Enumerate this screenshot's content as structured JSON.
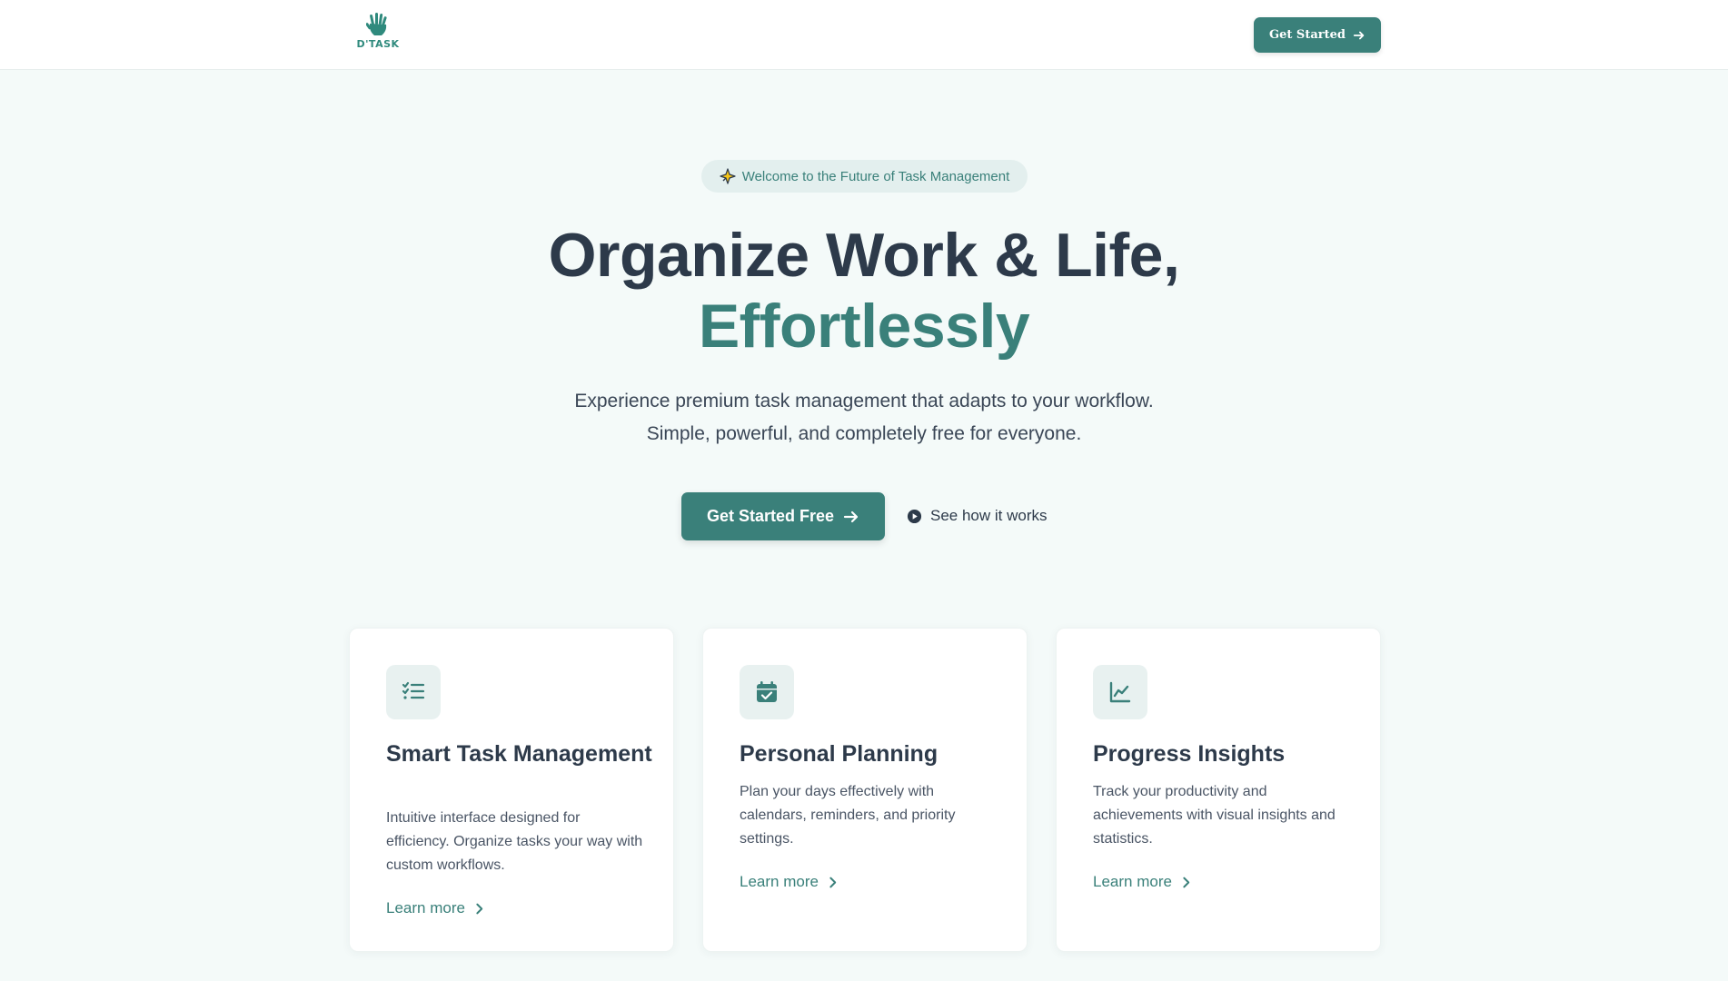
{
  "nav": {
    "logo_text": "D'TASK",
    "cta_label": "Get Started"
  },
  "hero": {
    "badge_icon": "sparkle-icon",
    "badge_text": "Welcome to the Future of Task Management",
    "title_line1": "Organize Work & Life,",
    "title_line2": "Effortlessly",
    "subtitle_line1": "Experience premium task management that adapts to your workflow.",
    "subtitle_line2": "Simple, powerful, and completely free for everyone.",
    "primary_cta": "Get Started Free",
    "secondary_cta": "See how it works"
  },
  "features": [
    {
      "icon": "checklist-icon",
      "title": "Smart Task Management",
      "description": "Intuitive interface designed for efficiency. Organize tasks your way with custom workflows.",
      "link": "Learn more"
    },
    {
      "icon": "calendar-check-icon",
      "title": "Personal Planning",
      "description": "Plan your days effectively with calendars, reminders, and priority settings.",
      "link": "Learn more"
    },
    {
      "icon": "line-chart-icon",
      "title": "Progress Insights",
      "description": "Track your productivity and achievements with visual insights and statistics.",
      "link": "Learn more"
    }
  ],
  "colors": {
    "accent": "#3a807a",
    "heading": "#2d3a4a",
    "background": "#f4faf9",
    "badge_bg": "#e3efee"
  }
}
